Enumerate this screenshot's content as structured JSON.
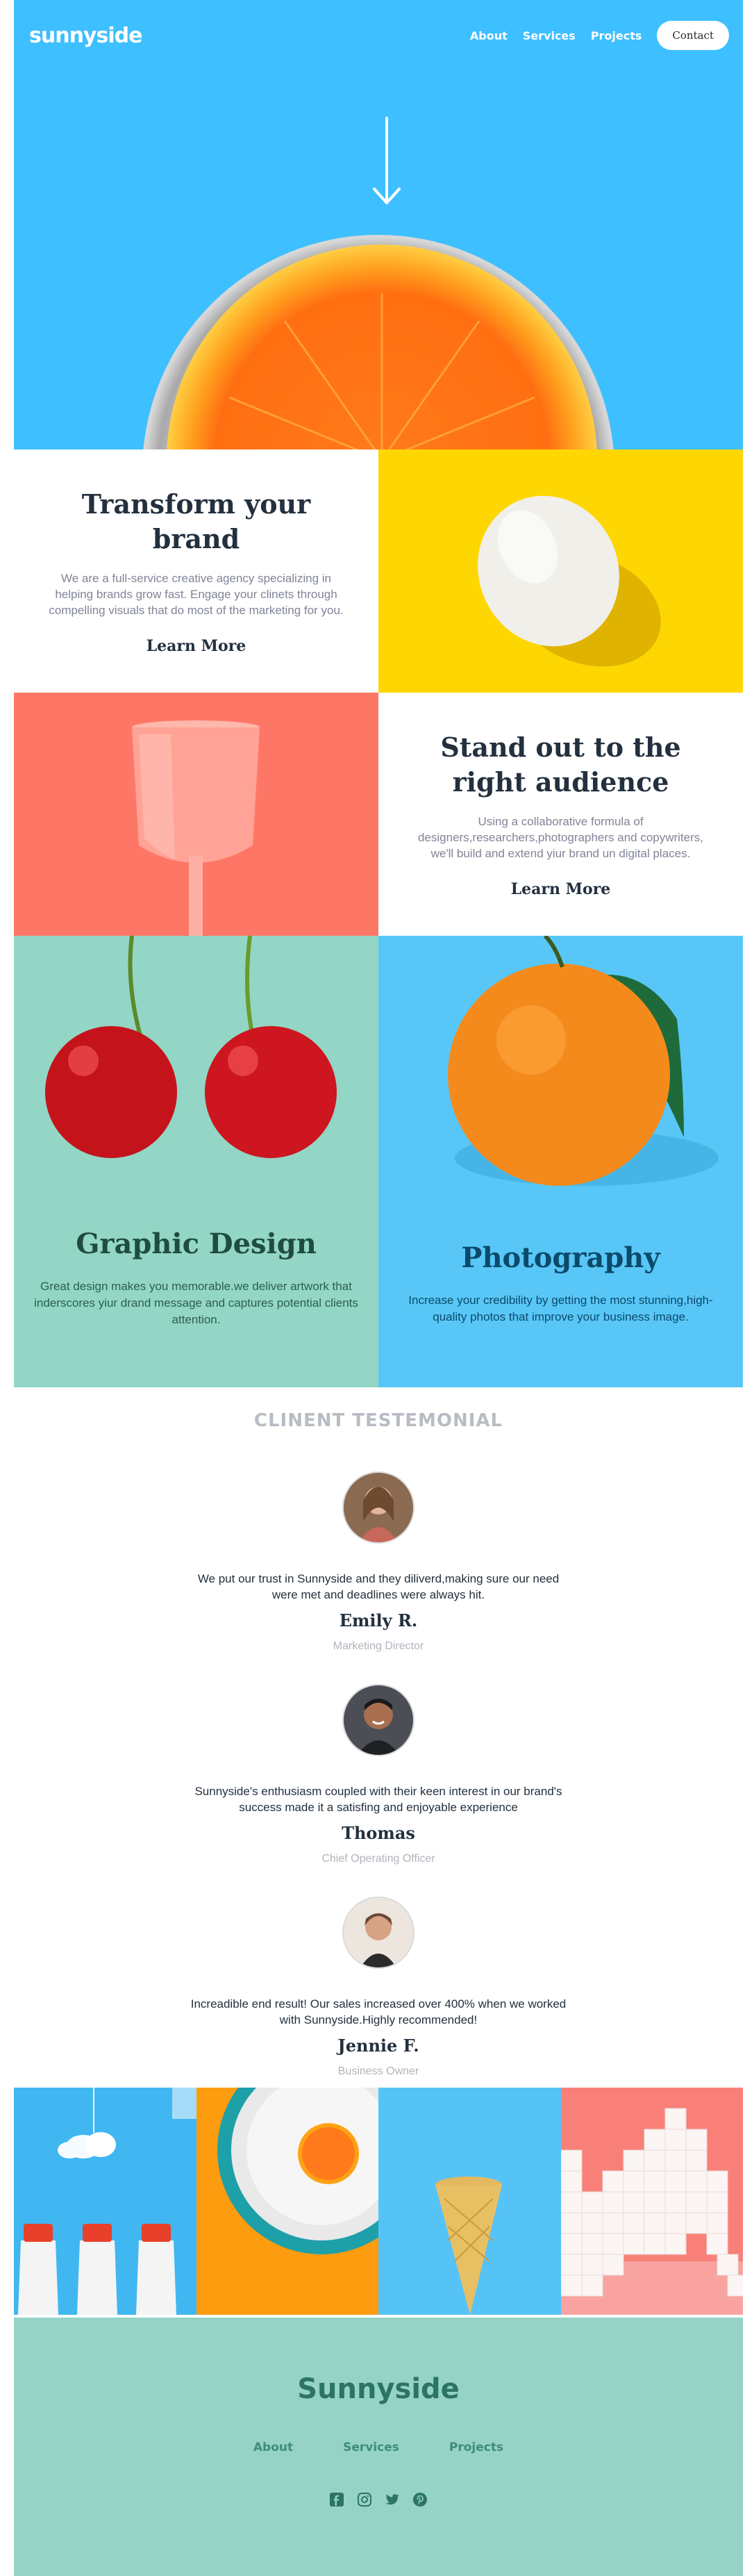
{
  "header": {
    "logo": "sunnyside",
    "nav": [
      "About",
      "Services",
      "Projects"
    ],
    "contact_label": "Contact"
  },
  "transform": {
    "title": "Transform your brand",
    "body": "We are a full-service creative agency specializing in helping brands grow fast. Engage your clinets through compelling visuals that do most of the marketing for you.",
    "link": "Learn More"
  },
  "standout": {
    "title": "Stand out to the right audience",
    "body": "Using a collaborative formula of designers,researchers,photographers and copywriters, we'll build and extend yiur brand un digital places.",
    "link": "Learn More"
  },
  "graphic": {
    "title": "Graphic Design",
    "body": "Great design makes you memorable.we deliver artwork that inderscores yiur drand message and captures potential clients attention."
  },
  "photography": {
    "title": "Photography",
    "body": "Increase your credibility by getting the most stunning,high-quality photos that improve your business image."
  },
  "testimonials": {
    "title": "CLINENT TESTEMONIAL",
    "items": [
      {
        "quote": "We put our trust in Sunnyside and they diliverd,making sure our need were met and deadlines were always hit.",
        "name": "Emily R.",
        "role": "Marketing Director"
      },
      {
        "quote": "Sunnyside's enthusiasm coupled with their keen interest in our brand's success made it a satisfing and enjoyable experience",
        "name": "Thomas",
        "role": "Chief Operating Officer"
      },
      {
        "quote": "Increadible end result! Our sales increased over 400% when we worked with Sunnyside.Highly recommended!",
        "name": "Jennie F.",
        "role": "Business Owner"
      }
    ]
  },
  "footer": {
    "logo": "Sunnyside",
    "nav": [
      "About",
      "Services",
      "Projects"
    ],
    "social": [
      "facebook-icon",
      "instagram-icon",
      "twitter-icon",
      "pinterest-icon"
    ]
  },
  "colors": {
    "hero_blue": "#3ebfff",
    "egg_yellow": "#fed703",
    "coral": "#fe7766",
    "mint": "#93d6c5",
    "sky": "#58c7f7",
    "dark_text": "#23303e",
    "footer_teal": "#2c7465"
  }
}
